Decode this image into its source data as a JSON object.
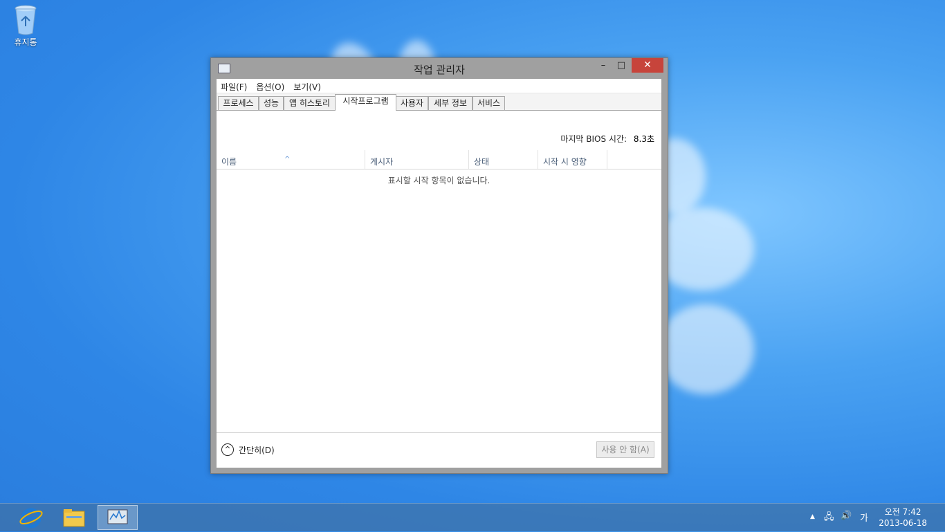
{
  "desktop": {
    "recycle_bin_label": "휴지통"
  },
  "window": {
    "title": "작업 관리자",
    "controls": {
      "minimize": "–",
      "maximize": "□",
      "close": "✕"
    }
  },
  "menu": [
    "파일(F)",
    "옵션(O)",
    "보기(V)"
  ],
  "tabs": [
    {
      "label": "프로세스",
      "active": false
    },
    {
      "label": "성능",
      "active": false
    },
    {
      "label": "앱 히스토리",
      "active": false
    },
    {
      "label": "시작프로그램",
      "active": true
    },
    {
      "label": "사용자",
      "active": false
    },
    {
      "label": "세부 정보",
      "active": false
    },
    {
      "label": "서비스",
      "active": false
    }
  ],
  "bios": {
    "label": "마지막 BIOS 시간:",
    "value": "8.3초"
  },
  "columns": [
    "이름",
    "게시자",
    "상태",
    "시작 시 영향"
  ],
  "empty_message": "표시할 시작 항목이 없습니다.",
  "footer": {
    "fewer_details": "간단히(D)",
    "disable_button": "사용 안 함(A)"
  },
  "taskbar": {
    "apps": [
      "internet-explorer-icon",
      "file-explorer-icon",
      "task-manager-icon"
    ],
    "ime": "가",
    "clock_time": "오전 7:42",
    "clock_date": "2013-06-18"
  },
  "colors": {
    "accent_close": "#c7443b",
    "desktop_blue": "#2e86e6"
  }
}
